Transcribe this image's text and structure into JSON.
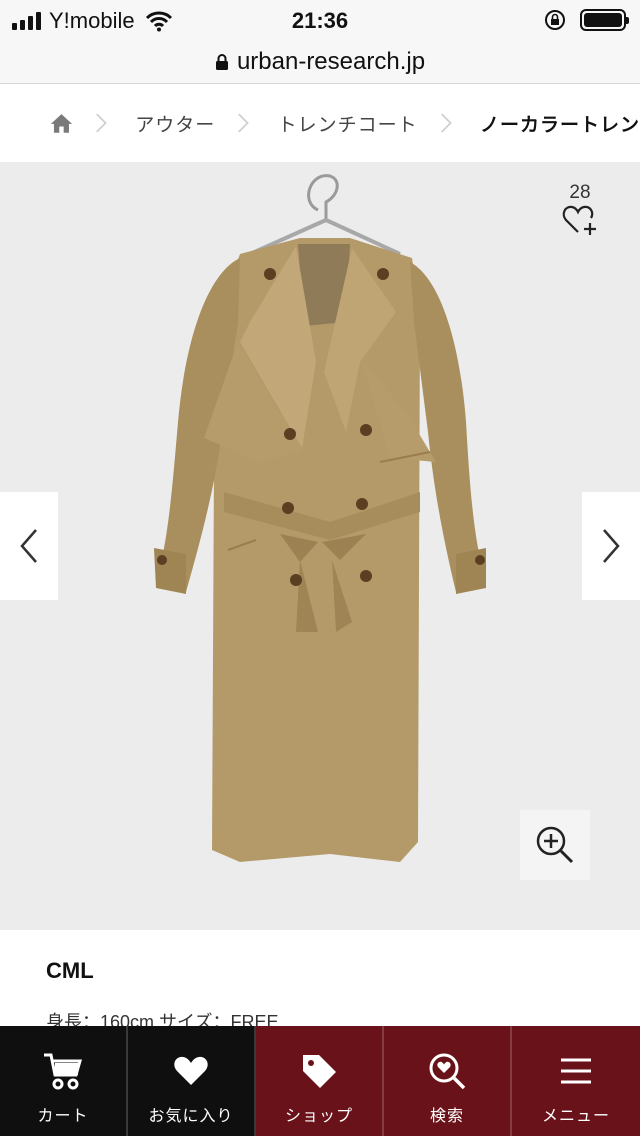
{
  "status_bar": {
    "carrier": "Y!mobile",
    "time": "21:36"
  },
  "browser": {
    "url": "urban-research.jp"
  },
  "breadcrumb": {
    "items": [
      "アウター",
      "トレンチコート",
      "ノーカラートレン"
    ]
  },
  "product": {
    "favorite_count": "28",
    "color_name": "CML",
    "size_info": "身長：160cm サイズ：FREE"
  },
  "bottom_nav": {
    "cart": "カート",
    "favorites": "お気に入り",
    "shop": "ショップ",
    "search": "検索",
    "menu": "メニュー"
  },
  "colors": {
    "nav_dark": "#0f0f0f",
    "nav_accent": "#6a1219",
    "image_background": "#ececec",
    "coat": "#b39a68"
  }
}
